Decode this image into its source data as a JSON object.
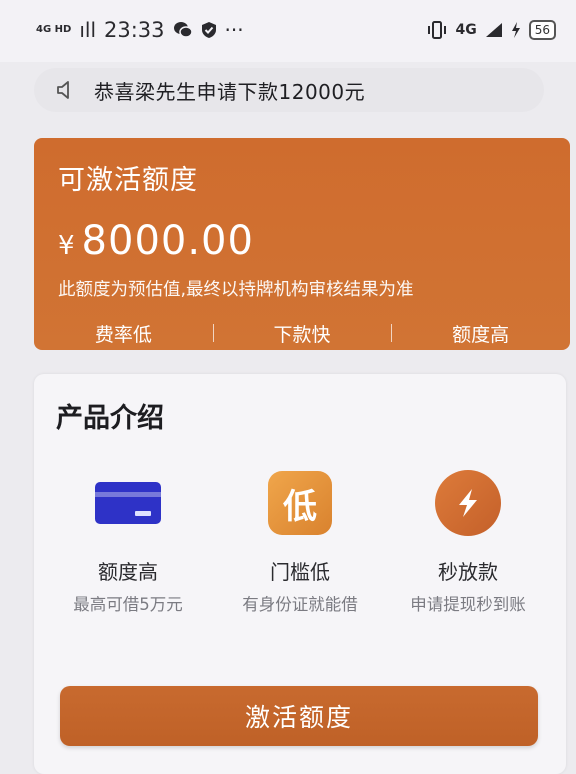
{
  "status_bar": {
    "network": "4G HD",
    "signal": "ıll",
    "time": "23:33",
    "more": "···",
    "right_network": "4G",
    "battery": "56"
  },
  "notice": {
    "text": "恭喜梁先生申请下款12000元"
  },
  "credit": {
    "title": "可激活额度",
    "currency": "¥",
    "amount": "8000.00",
    "note": "此额度为预估值,最终以持牌机构审核结果为准",
    "tags": [
      "费率低",
      "下款快",
      "额度高"
    ]
  },
  "product": {
    "title": "产品介绍",
    "features": [
      {
        "icon": "bank-card-icon",
        "title": "额度高",
        "desc": "最高可借5万元"
      },
      {
        "icon": "low-badge-icon",
        "icon_text": "低",
        "title": "门槛低",
        "desc": "有身份证就能借"
      },
      {
        "icon": "lightning-icon",
        "title": "秒放款",
        "desc": "申请提现秒到账"
      }
    ]
  },
  "action": {
    "activate_label": "激活额度"
  },
  "colors": {
    "accent": "#cf6c2e",
    "card_blue": "#2e32c7"
  }
}
